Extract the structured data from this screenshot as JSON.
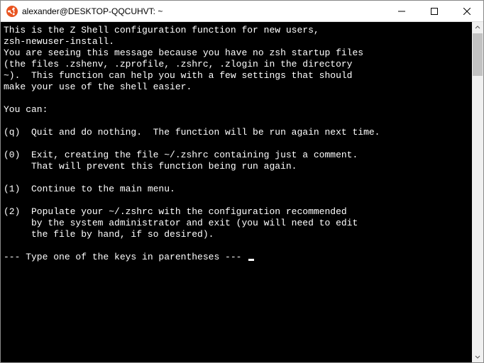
{
  "titlebar": {
    "title": "alexander@DESKTOP-QQCUHVT: ~"
  },
  "terminal": {
    "lines": [
      "This is the Z Shell configuration function for new users,",
      "zsh-newuser-install.",
      "You are seeing this message because you have no zsh startup files",
      "(the files .zshenv, .zprofile, .zshrc, .zlogin in the directory",
      "~).  This function can help you with a few settings that should",
      "make your use of the shell easier.",
      "",
      "You can:",
      "",
      "(q)  Quit and do nothing.  The function will be run again next time.",
      "",
      "(0)  Exit, creating the file ~/.zshrc containing just a comment.",
      "     That will prevent this function being run again.",
      "",
      "(1)  Continue to the main menu.",
      "",
      "(2)  Populate your ~/.zshrc with the configuration recommended",
      "     by the system administrator and exit (you will need to edit",
      "     the file by hand, if so desired).",
      ""
    ],
    "prompt": "--- Type one of the keys in parentheses --- "
  }
}
